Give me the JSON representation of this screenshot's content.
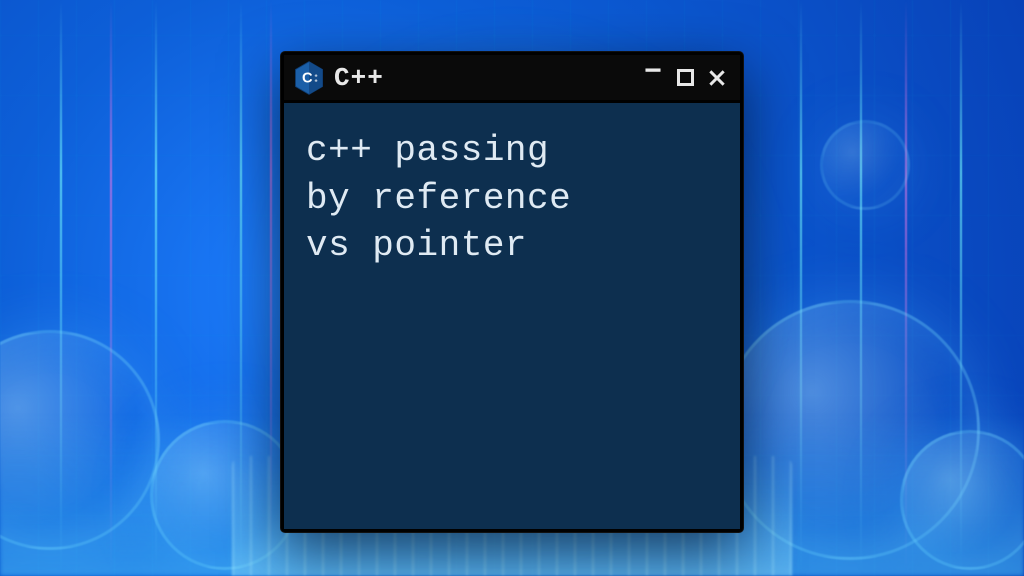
{
  "window": {
    "title": "C++",
    "icon": "cpp-hex-icon",
    "controls": {
      "minimize": "−",
      "maximize": "☐",
      "close": "×"
    }
  },
  "content": {
    "lines": [
      "c++ passing",
      "by reference",
      "vs pointer"
    ]
  },
  "colors": {
    "background_accent": "#1e7fff",
    "window_bg": "#0a0a0a",
    "content_bg": "#0d2f4f",
    "text": "#dfeaf3",
    "titlebar_text": "#e8e8e8",
    "cpp_badge": "#1b5fa8"
  }
}
